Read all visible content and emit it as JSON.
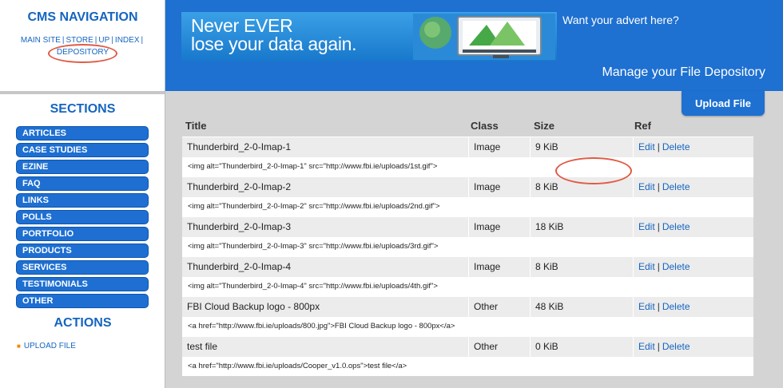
{
  "nav": {
    "title": "CMS NAVIGATION",
    "links": [
      "MAIN SITE",
      "STORE",
      "UP",
      "INDEX"
    ],
    "depository": "DEPOSITORY"
  },
  "sections": {
    "title": "SECTIONS",
    "items": [
      "ARTICLES",
      "CASE STUDIES",
      "EZINE",
      "FAQ",
      "LINKS",
      "POLLS",
      "PORTFOLIO",
      "PRODUCTS",
      "SERVICES",
      "TESTIMONIALS",
      "OTHER"
    ]
  },
  "actions": {
    "title": "ACTIONS",
    "upload": "UPLOAD FILE"
  },
  "banner": {
    "ad_line1": "Never EVER",
    "ad_line2": "lose your data again.",
    "advert": "Want your advert here?",
    "page_title": "Manage your File Depository"
  },
  "upload_button": "Upload File",
  "table": {
    "headers": {
      "title": "Title",
      "class": "Class",
      "size": "Size",
      "ref": "Ref"
    },
    "edit": "Edit",
    "delete": "Delete",
    "rows": [
      {
        "title": "Thunderbird_2-0-Imap-1",
        "class": "Image",
        "size": "9 KiB",
        "code": "<img alt=\"Thunderbird_2-0-Imap-1\" src=\"http://www.fbi.ie/uploads/1st.gif\">"
      },
      {
        "title": "Thunderbird_2-0-Imap-2",
        "class": "Image",
        "size": "8 KiB",
        "code": "<img alt=\"Thunderbird_2-0-Imap-2\" src=\"http://www.fbi.ie/uploads/2nd.gif\">"
      },
      {
        "title": "Thunderbird_2-0-Imap-3",
        "class": "Image",
        "size": "18 KiB",
        "code": "<img alt=\"Thunderbird_2-0-Imap-3\" src=\"http://www.fbi.ie/uploads/3rd.gif\">"
      },
      {
        "title": "Thunderbird_2-0-Imap-4",
        "class": "Image",
        "size": "8 KiB",
        "code": "<img alt=\"Thunderbird_2-0-Imap-4\" src=\"http://www.fbi.ie/uploads/4th.gif\">"
      },
      {
        "title": "FBI Cloud Backup logo - 800px",
        "class": "Other",
        "size": "48 KiB",
        "code": "<a href=\"http://www.fbi.ie/uploads/800.jpg\">FBI Cloud Backup logo - 800px</a>"
      },
      {
        "title": "test file",
        "class": "Other",
        "size": "0 KiB",
        "code": "<a href=\"http://www.fbi.ie/uploads/Cooper_v1.0.ops\">test file</a>"
      }
    ]
  },
  "colors": {
    "brand_blue": "#1e70d1",
    "annotation": "#e15a45"
  }
}
